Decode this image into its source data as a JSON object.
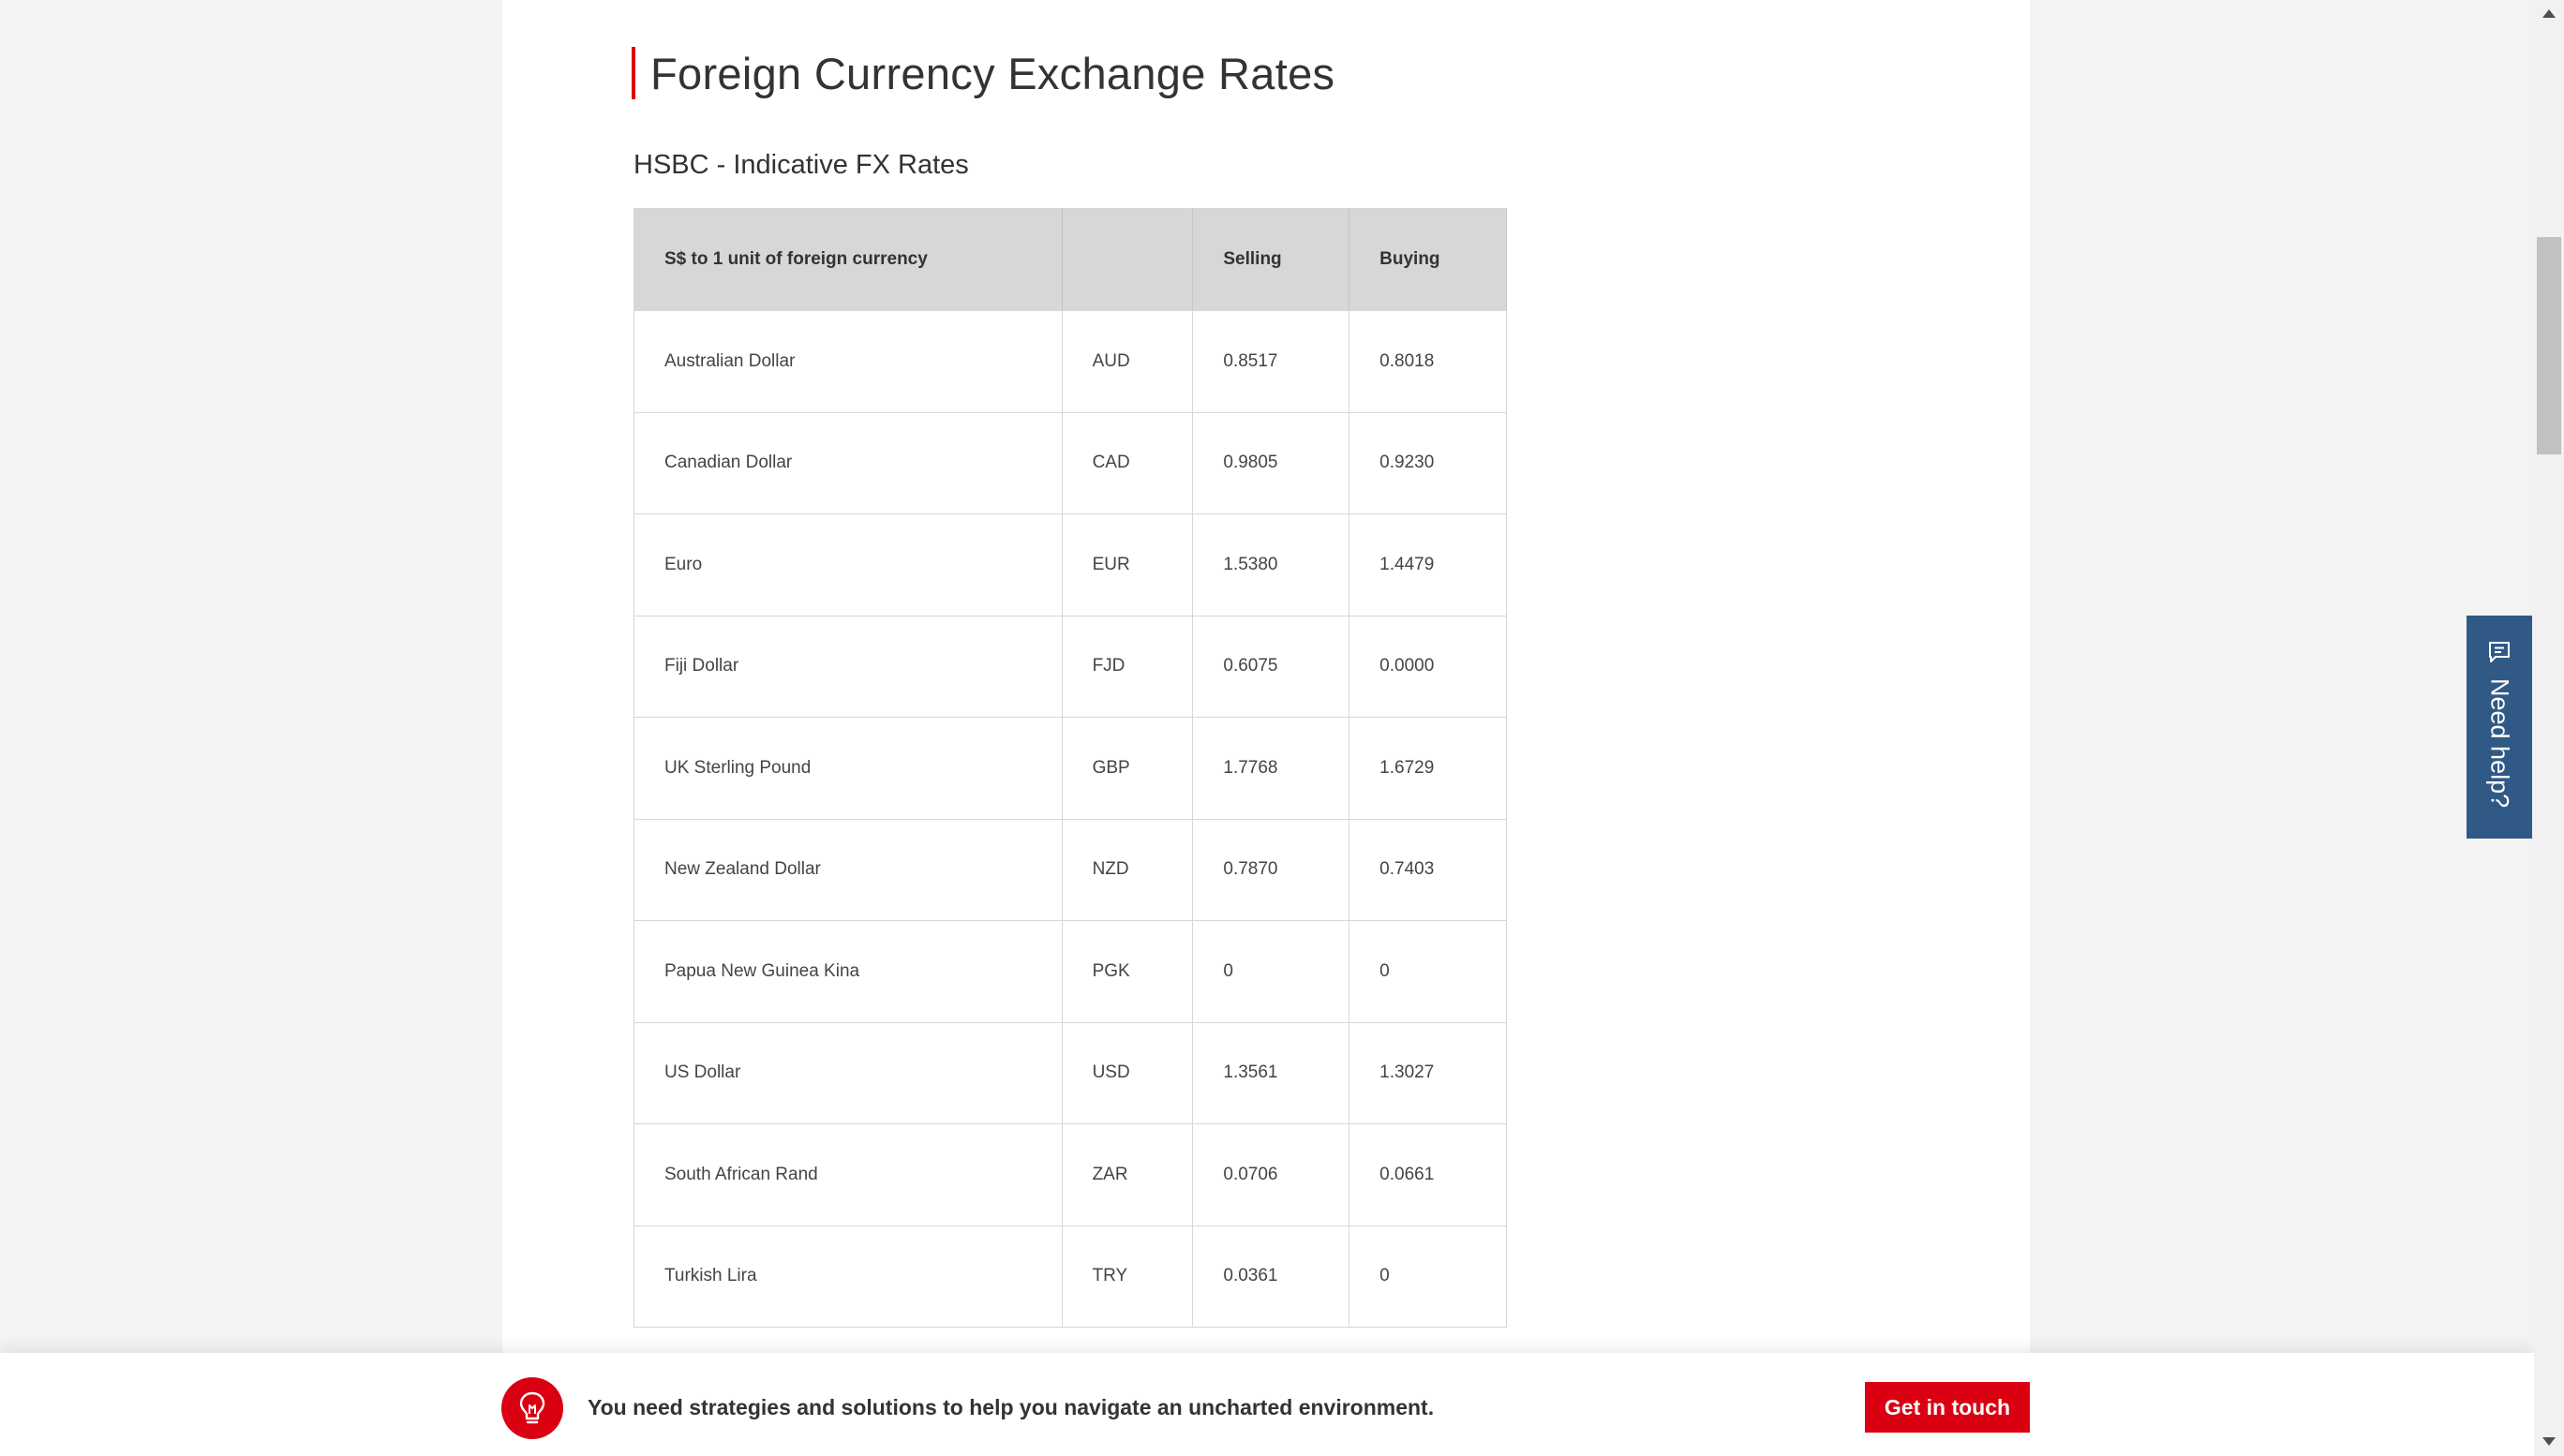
{
  "page": {
    "title": "Foreign Currency Exchange Rates",
    "subtitle": "HSBC - Indicative FX Rates"
  },
  "table": {
    "headers": [
      "S$ to 1 unit of foreign currency",
      "",
      "Selling",
      "Buying"
    ],
    "rows": [
      {
        "name": "Australian Dollar",
        "code": "AUD",
        "selling": "0.8517",
        "buying": "0.8018"
      },
      {
        "name": "Canadian Dollar",
        "code": "CAD",
        "selling": "0.9805",
        "buying": "0.9230"
      },
      {
        "name": "Euro",
        "code": "EUR",
        "selling": "1.5380",
        "buying": "1.4479"
      },
      {
        "name": "Fiji Dollar",
        "code": "FJD",
        "selling": "0.6075",
        "buying": "0.0000"
      },
      {
        "name": "UK Sterling Pound",
        "code": "GBP",
        "selling": "1.7768",
        "buying": "1.6729"
      },
      {
        "name": "New Zealand Dollar",
        "code": "NZD",
        "selling": "0.7870",
        "buying": "0.7403"
      },
      {
        "name": "Papua New Guinea Kina",
        "code": "PGK",
        "selling": "0",
        "buying": "0"
      },
      {
        "name": "US Dollar",
        "code": "USD",
        "selling": "1.3561",
        "buying": "1.3027"
      },
      {
        "name": "South African Rand",
        "code": "ZAR",
        "selling": "0.0706",
        "buying": "0.0661"
      },
      {
        "name": "Turkish Lira",
        "code": "TRY",
        "selling": "0.0361",
        "buying": "0"
      }
    ]
  },
  "banner": {
    "icon": "lightbulb-icon",
    "text": "You need strategies and solutions to help you navigate an uncharted environment.",
    "cta_label": "Get in touch"
  },
  "help_tab": {
    "icon": "chat-icon",
    "label": "Need help?"
  },
  "colors": {
    "brand_red": "#db0011",
    "help_blue": "#305a85",
    "header_gray": "#d7d7d7"
  }
}
